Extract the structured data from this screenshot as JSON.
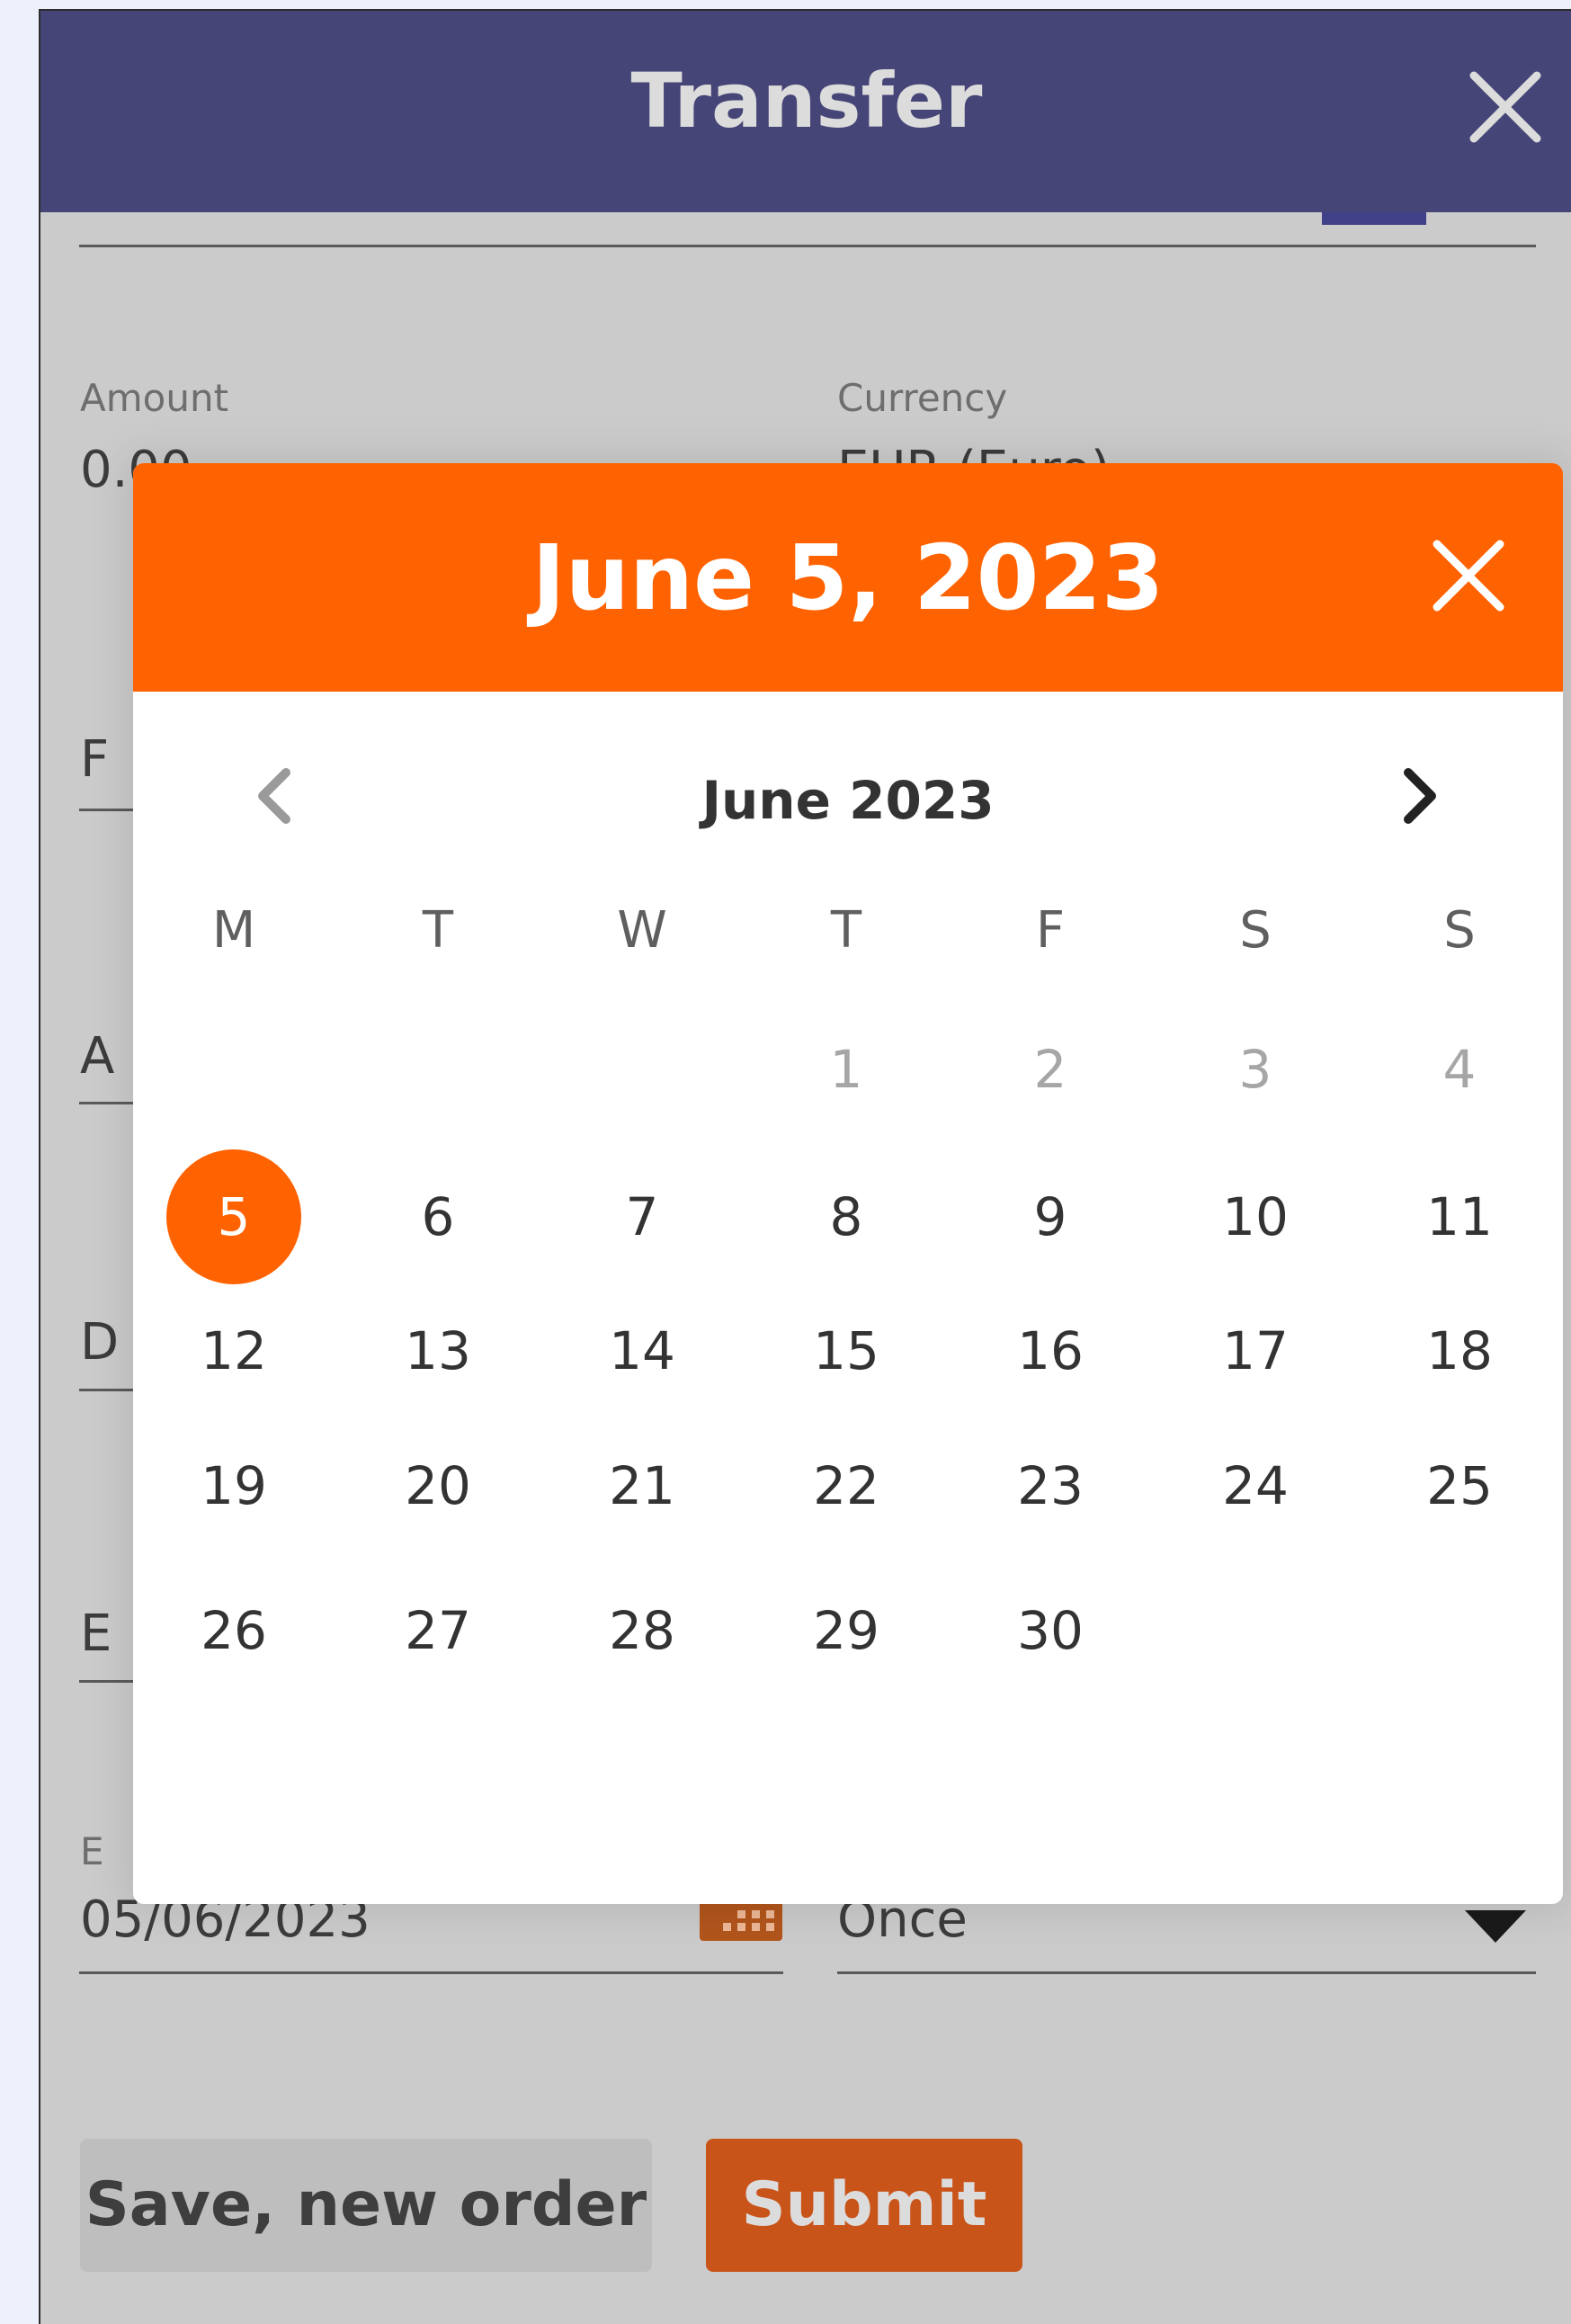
{
  "header": {
    "title": "Transfer"
  },
  "form": {
    "amount_label": "Amount",
    "amount_value": "0.00",
    "currency_label": "Currency",
    "currency_value": "EUR (Euro)",
    "execution_label": "E",
    "execution_value": "05/06/2023",
    "frequency_value": "Once",
    "hidden_initials": [
      "F",
      "A",
      "D",
      "E"
    ]
  },
  "buttons": {
    "save": "Save, new order",
    "submit": "Submit"
  },
  "date_picker": {
    "selected_date": "June 5, 2023",
    "month": "June 2023",
    "weekdays": [
      "M",
      "T",
      "W",
      "T",
      "F",
      "S",
      "S"
    ],
    "weeks": [
      [
        "",
        "",
        "",
        "1",
        "2",
        "3",
        "4"
      ],
      [
        "5",
        "6",
        "7",
        "8",
        "9",
        "10",
        "11"
      ],
      [
        "12",
        "13",
        "14",
        "15",
        "16",
        "17",
        "18"
      ],
      [
        "19",
        "20",
        "21",
        "22",
        "23",
        "24",
        "25"
      ],
      [
        "26",
        "27",
        "28",
        "29",
        "30",
        "",
        ""
      ]
    ],
    "selected_day": "5",
    "muted_days": [
      "1",
      "2",
      "3",
      "4"
    ]
  },
  "colors": {
    "header": "#454577",
    "accent_orange": "#ff6200",
    "overlay": "#cbcbcb",
    "submit": "#c9541a"
  }
}
